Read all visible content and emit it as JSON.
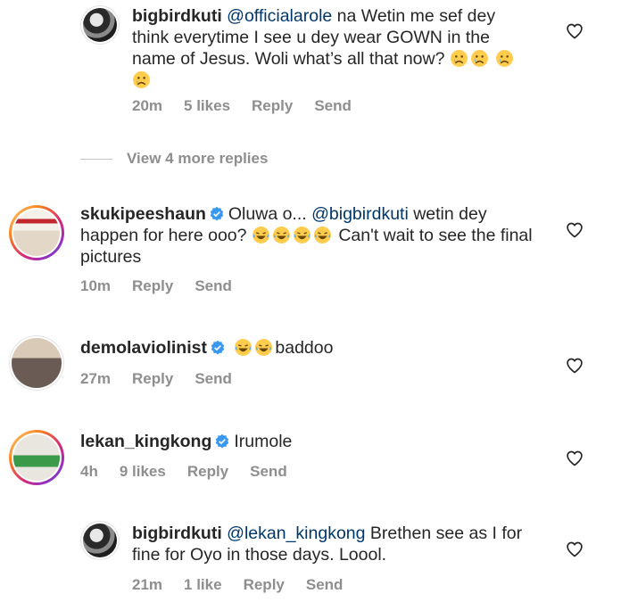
{
  "comments": [
    {
      "username": "bigbirdkuti",
      "mention": "@officialarole",
      "text": " na Wetin me sef dey think everytime I see u dey wear GOWN in the name of Jesus. Woli what’s all that now?",
      "time": "20m",
      "likes": "5 likes",
      "reply": "Reply",
      "send": "Send"
    },
    {
      "username": "skukipeeshaun",
      "text_before": "Oluwa o... ",
      "mention": "@bigbirdkuti",
      "text_after": " wetin dey happen for here ooo?",
      "text_end": " Can't wait to see the final pictures",
      "time": "10m",
      "reply": "Reply",
      "send": "Send"
    },
    {
      "username": "demolaviolinist",
      "text": "baddoo",
      "time": "27m",
      "reply": "Reply",
      "send": "Send"
    },
    {
      "username": "lekan_kingkong",
      "text": "Irumole",
      "time": "4h",
      "likes": "9 likes",
      "reply": "Reply",
      "send": "Send"
    },
    {
      "username": "bigbirdkuti",
      "mention": "@lekan_kingkong",
      "text": " Brethen see as I for fine for Oyo in those days. Loool.",
      "time": "21m",
      "likes": "1 like",
      "reply": "Reply",
      "send": "Send"
    }
  ],
  "view_more_replies": "View 4 more replies",
  "colors": {
    "mention": "#00376b",
    "meta": "#8e8e8e",
    "verified": "#3897f0"
  },
  "icons": {
    "like": "heart-outline-icon",
    "verified": "verified-badge-icon",
    "emoji_crying": "crying-face-emoji",
    "emoji_laughing": "tears-of-joy-emoji"
  }
}
